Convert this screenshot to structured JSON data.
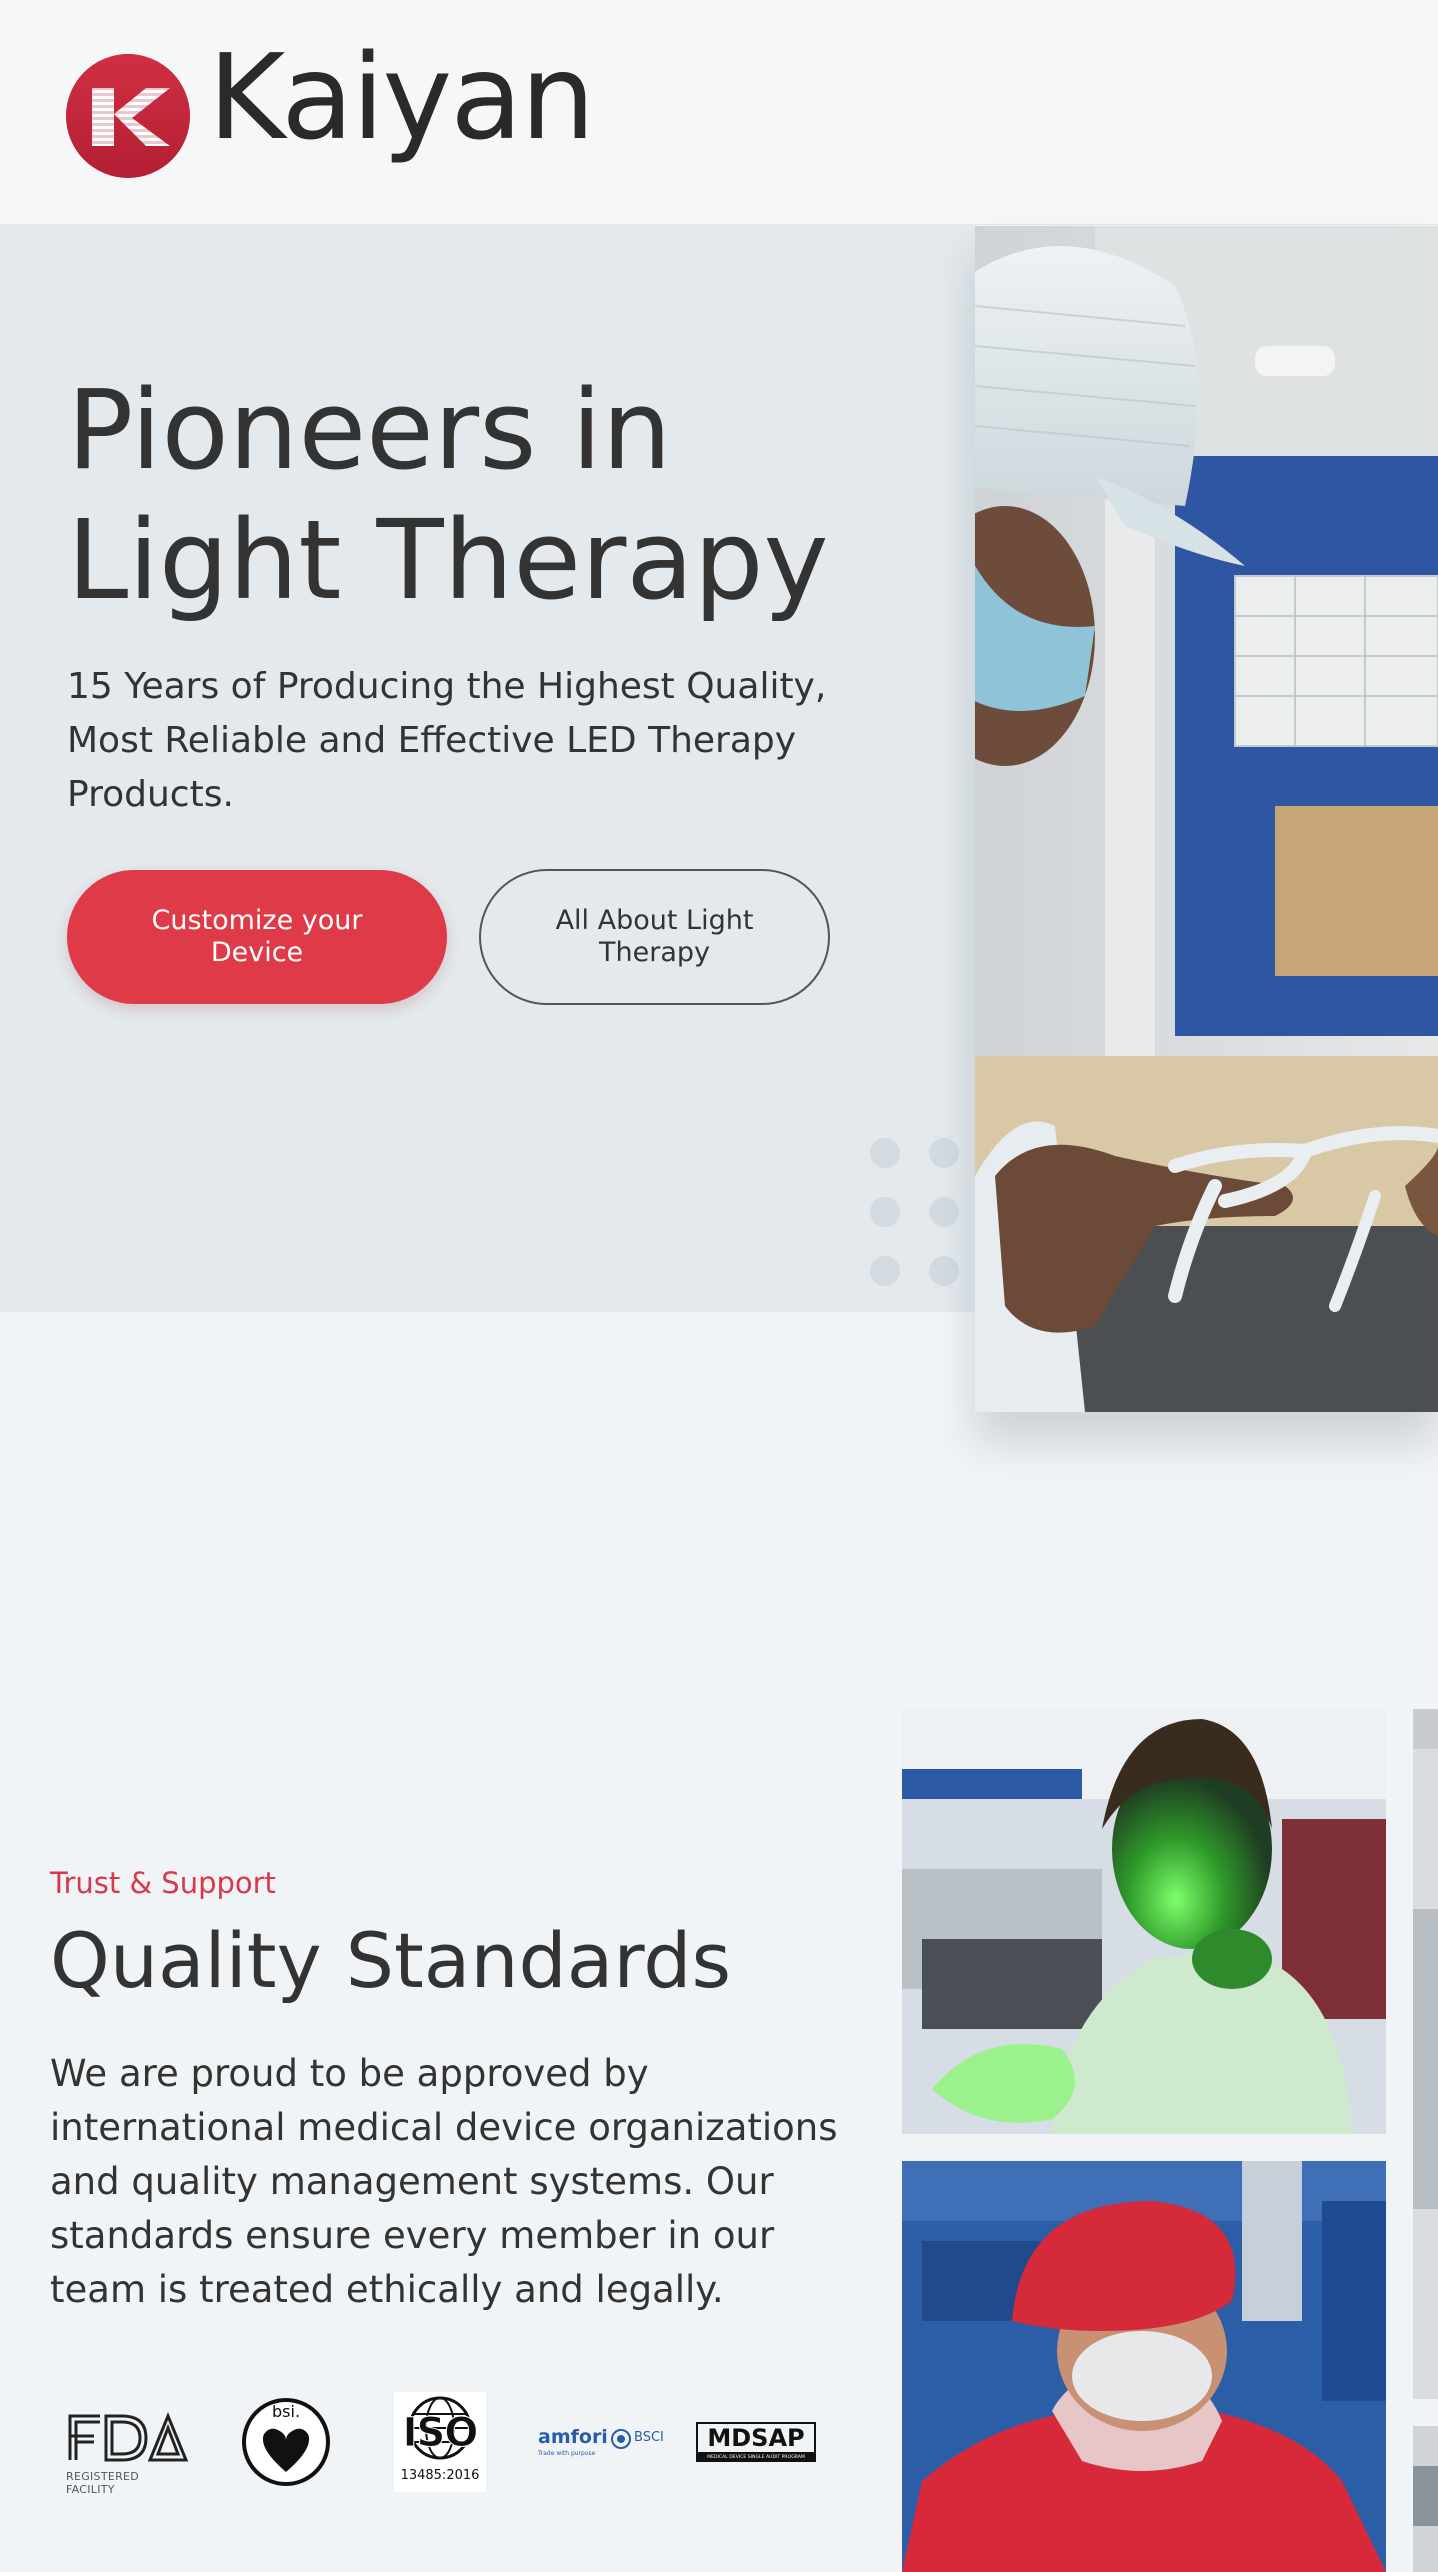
{
  "brand": {
    "name": "Kaiyan",
    "color": "#c8283c",
    "logo_icon": "k-logo-icon"
  },
  "hero": {
    "title_line1": "Pioneers in",
    "title_line2": "Light Therapy",
    "subtitle": "15 Years of Producing the Highest Quality, Most Reliable and Effective LED Therapy Products.",
    "primary_button": "Customize your Device",
    "secondary_button": "All About Light Therapy",
    "accent_color": "#de3a47"
  },
  "quality": {
    "eyebrow": "Trust & Support",
    "title": "Quality Standards",
    "text": "We are proud to be approved by international medical device organizations and quality management systems. Our standards ensure every member in our team is treated ethically and legally."
  },
  "certifications": {
    "fda_caption": "REGISTERED FACILITY",
    "bsi_label": "bsi.",
    "iso_label": "ISO",
    "iso_caption": "13485:2016",
    "amfori_label": "amfori",
    "amfori_tagline": "Trade with purpose",
    "bsci_label": "BSCI",
    "mdsap_label": "MDSAP",
    "mdsap_caption": "MEDICAL DEVICE SINGLE AUDIT PROGRAM"
  },
  "photos": {
    "hero": "factory-worker-photo",
    "gallery": [
      "green-light-mask-photo",
      "red-cap-worker-photo",
      "gallery-photo-3",
      "gallery-photo-4"
    ]
  }
}
